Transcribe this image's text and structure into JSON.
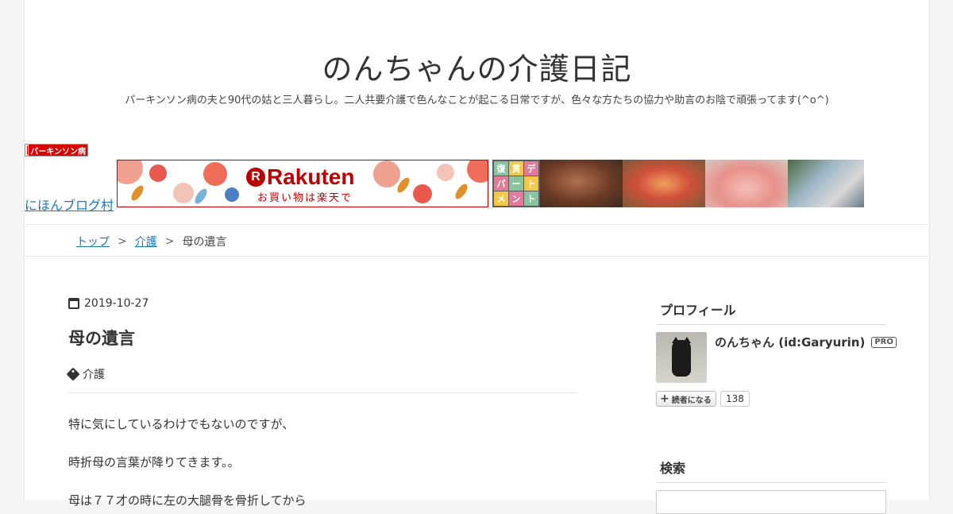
{
  "header": {
    "title": "のんちゃんの介護日記",
    "description": "パーキンソン病の夫と90代の姑と三人暮らし。二人共要介護で色んなことが起こる日常ですが、色々な方たちの協力や助言のお陰で頑張ってます(^o^)"
  },
  "ads": {
    "badge_label": "パーキンソン病",
    "village_link": "にほんブログ村",
    "rakuten_logo": "Rakuten",
    "rakuten_sub": "お買い物は楽天で",
    "dept_cells": [
      "復",
      "貫",
      "デ",
      "パ",
      "ー",
      "ト",
      "メ",
      "ン",
      "ト"
    ]
  },
  "breadcrumb": {
    "items": [
      "トップ",
      "介護",
      "母の遺言"
    ],
    "separator": ">"
  },
  "post": {
    "date": "2019-10-27",
    "title": "母の遺言",
    "category": "介護",
    "paragraphs": [
      "特に気にしているわけでもないのですが、",
      "時折母の言葉が降りてきます。。",
      "母は７７才の時に左の大腿骨を骨折してから"
    ]
  },
  "sidebar": {
    "profile_heading": "プロフィール",
    "profile_name": "のんちゃん (id:Garyurin)",
    "pro_badge": "PRO",
    "reader_button": "読者になる",
    "reader_count": "138",
    "search_heading": "検索"
  },
  "colors": {
    "link": "#1a79b8",
    "rakuten_red": "#bf0000",
    "text": "#333333"
  }
}
